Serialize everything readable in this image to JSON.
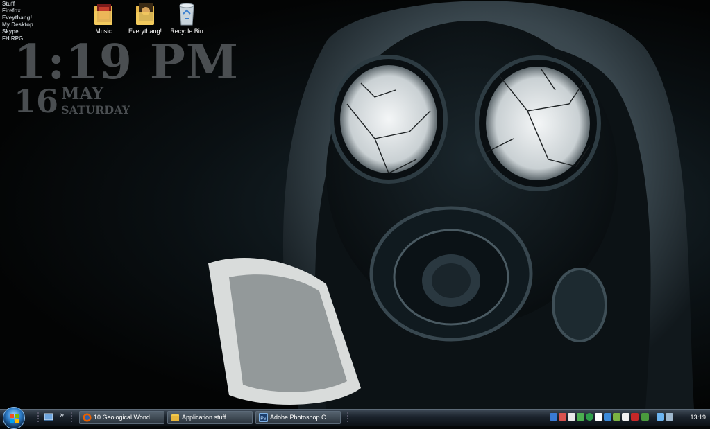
{
  "launcher": {
    "items": [
      "Stuff",
      "Firefox",
      "Eveythang!",
      "My Desktop",
      "Skype",
      "FH RPG"
    ]
  },
  "clock_widget": {
    "time": "1:19 PM",
    "day": "16",
    "month": "MAY",
    "weekday": "SATURDAY"
  },
  "desktop_icons": {
    "music": {
      "label": "Music",
      "icon": "folder-icon"
    },
    "everythang": {
      "label": "Everythang!",
      "icon": "folder-icon"
    },
    "recycle_bin": {
      "label": "Recycle Bin",
      "icon": "recycle-bin-icon"
    }
  },
  "taskbar": {
    "quicklaunch_more": "»",
    "tasks": [
      {
        "label": "10 Geological Wond...",
        "icon": "firefox-icon"
      },
      {
        "label": "Application stuff",
        "icon": "folder-icon"
      },
      {
        "label": "Adobe Photoshop C...",
        "icon": "photoshop-icon"
      }
    ],
    "clock": "13:19"
  },
  "colors": {
    "widget_text": "#4a4e51",
    "taskbar": "#1b232c",
    "accent": "#2f7ec9"
  }
}
